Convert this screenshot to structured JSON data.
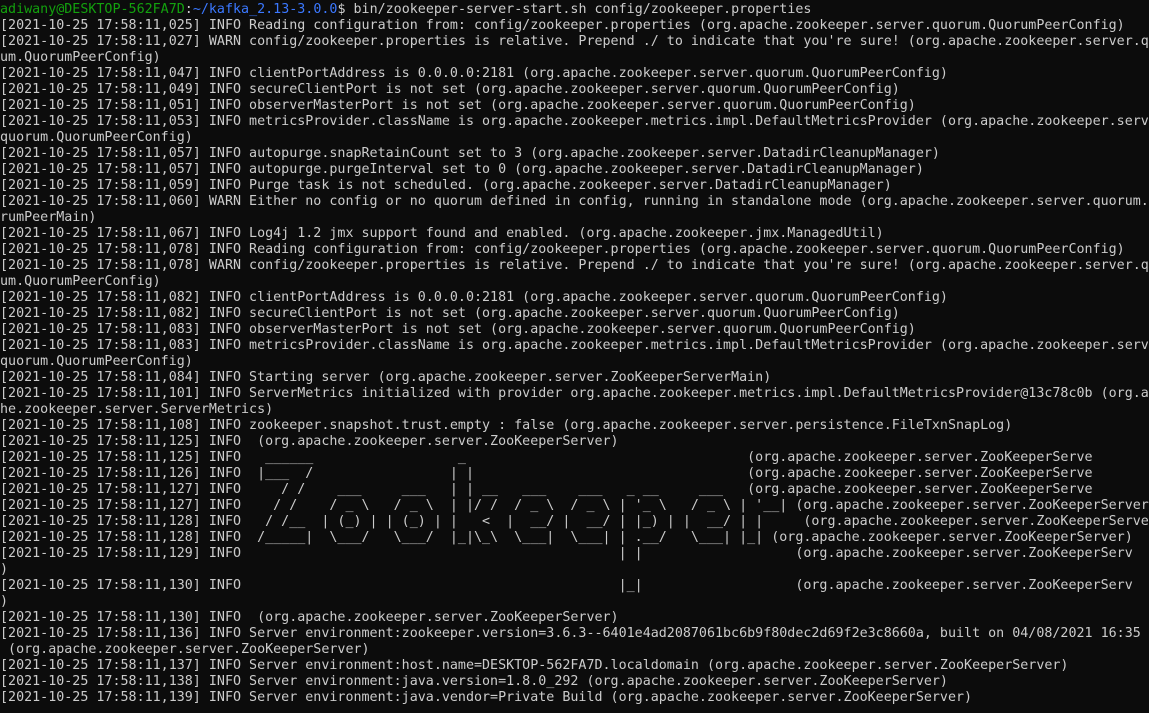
{
  "prompt": {
    "user_host": "adiwany@DESKTOP-562FA7D",
    "separator": ":",
    "path": "~/kafka_2.13-3.0.0",
    "symbol": "$ ",
    "command": "bin/zookeeper-server-start.sh config/zookeeper.properties"
  },
  "colors": {
    "background": "#0c0c0c",
    "text": "#cccccc",
    "prompt_user": "#13a10e",
    "prompt_path": "#3b78ff"
  },
  "log_lines": [
    "[2021-10-25 17:58:11,025] INFO Reading configuration from: config/zookeeper.properties (org.apache.zookeeper.server.quorum.QuorumPeerConfig)",
    "[2021-10-25 17:58:11,027] WARN config/zookeeper.properties is relative. Prepend ./ to indicate that you're sure! (org.apache.zookeeper.server.qu",
    "um.QuorumPeerConfig)",
    "[2021-10-25 17:58:11,047] INFO clientPortAddress is 0.0.0.0:2181 (org.apache.zookeeper.server.quorum.QuorumPeerConfig)",
    "[2021-10-25 17:58:11,049] INFO secureClientPort is not set (org.apache.zookeeper.server.quorum.QuorumPeerConfig)",
    "[2021-10-25 17:58:11,051] INFO observerMasterPort is not set (org.apache.zookeeper.server.quorum.QuorumPeerConfig)",
    "[2021-10-25 17:58:11,053] INFO metricsProvider.className is org.apache.zookeeper.metrics.impl.DefaultMetricsProvider (org.apache.zookeeper.serve",
    "quorum.QuorumPeerConfig)",
    "[2021-10-25 17:58:11,057] INFO autopurge.snapRetainCount set to 3 (org.apache.zookeeper.server.DatadirCleanupManager)",
    "[2021-10-25 17:58:11,057] INFO autopurge.purgeInterval set to 0 (org.apache.zookeeper.server.DatadirCleanupManager)",
    "[2021-10-25 17:58:11,059] INFO Purge task is not scheduled. (org.apache.zookeeper.server.DatadirCleanupManager)",
    "[2021-10-25 17:58:11,060] WARN Either no config or no quorum defined in config, running in standalone mode (org.apache.zookeeper.server.quorum.Q",
    "rumPeerMain)",
    "[2021-10-25 17:58:11,067] INFO Log4j 1.2 jmx support found and enabled. (org.apache.zookeeper.jmx.ManagedUtil)",
    "[2021-10-25 17:58:11,078] INFO Reading configuration from: config/zookeeper.properties (org.apache.zookeeper.server.quorum.QuorumPeerConfig)",
    "[2021-10-25 17:58:11,078] WARN config/zookeeper.properties is relative. Prepend ./ to indicate that you're sure! (org.apache.zookeeper.server.qu",
    "um.QuorumPeerConfig)",
    "[2021-10-25 17:58:11,082] INFO clientPortAddress is 0.0.0.0:2181 (org.apache.zookeeper.server.quorum.QuorumPeerConfig)",
    "[2021-10-25 17:58:11,082] INFO secureClientPort is not set (org.apache.zookeeper.server.quorum.QuorumPeerConfig)",
    "[2021-10-25 17:58:11,083] INFO observerMasterPort is not set (org.apache.zookeeper.server.quorum.QuorumPeerConfig)",
    "[2021-10-25 17:58:11,083] INFO metricsProvider.className is org.apache.zookeeper.metrics.impl.DefaultMetricsProvider (org.apache.zookeeper.serve",
    "quorum.QuorumPeerConfig)",
    "[2021-10-25 17:58:11,084] INFO Starting server (org.apache.zookeeper.server.ZooKeeperServerMain)",
    "[2021-10-25 17:58:11,101] INFO ServerMetrics initialized with provider org.apache.zookeeper.metrics.impl.DefaultMetricsProvider@13c78c0b (org.ap",
    "he.zookeeper.server.ServerMetrics)",
    "[2021-10-25 17:58:11,108] INFO zookeeper.snapshot.trust.empty : false (org.apache.zookeeper.server.persistence.FileTxnSnapLog)",
    "[2021-10-25 17:58:11,125] INFO  (org.apache.zookeeper.server.ZooKeeperServer)",
    "[2021-10-25 17:58:11,125] INFO   ______                  _                                   (org.apache.zookeeper.server.ZooKeeperServe",
    "[2021-10-25 17:58:11,126] INFO  |___  /                 | |                                  (org.apache.zookeeper.server.ZooKeeperServe",
    "[2021-10-25 17:58:11,127] INFO     / /    ___     ___   | | __   ___    ___   _ __     ___   (org.apache.zookeeper.server.ZooKeeperServe",
    "[2021-10-25 17:58:11,127] INFO    / /    / _ \\   / _ \\  | |/ /  / _ \\  / _ \\ | '_ \\   / _ \\ | '__| (org.apache.zookeeper.server.ZooKeeperServer)",
    "[2021-10-25 17:58:11,128] INFO   / /__  | (_) | | (_) | |   <  |  __/ |  __/ | |_) | |  __/ | |     (org.apache.zookeeper.server.ZooKeeperServe",
    "[2021-10-25 17:58:11,128] INFO  /_____|  \\___/   \\___/  |_|\\_\\  \\___|  \\___| | .__/   \\___| |_| (org.apache.zookeeper.server.ZooKeeperServer)",
    "[2021-10-25 17:58:11,129] INFO                                               | |                   (org.apache.zookeeper.server.ZooKeeperServ",
    ")",
    "[2021-10-25 17:58:11,130] INFO                                               |_|                   (org.apache.zookeeper.server.ZooKeeperServ",
    ")",
    "[2021-10-25 17:58:11,130] INFO  (org.apache.zookeeper.server.ZooKeeperServer)",
    "[2021-10-25 17:58:11,136] INFO Server environment:zookeeper.version=3.6.3--6401e4ad2087061bc6b9f80dec2d69f2e3c8660a, built on 04/08/2021 16:35 G",
    " (org.apache.zookeeper.server.ZooKeeperServer)",
    "[2021-10-25 17:58:11,137] INFO Server environment:host.name=DESKTOP-562FA7D.localdomain (org.apache.zookeeper.server.ZooKeeperServer)",
    "[2021-10-25 17:58:11,138] INFO Server environment:java.version=1.8.0_292 (org.apache.zookeeper.server.ZooKeeperServer)",
    "[2021-10-25 17:58:11,139] INFO Server environment:java.vendor=Private Build (org.apache.zookeeper.server.ZooKeeperServer)"
  ]
}
